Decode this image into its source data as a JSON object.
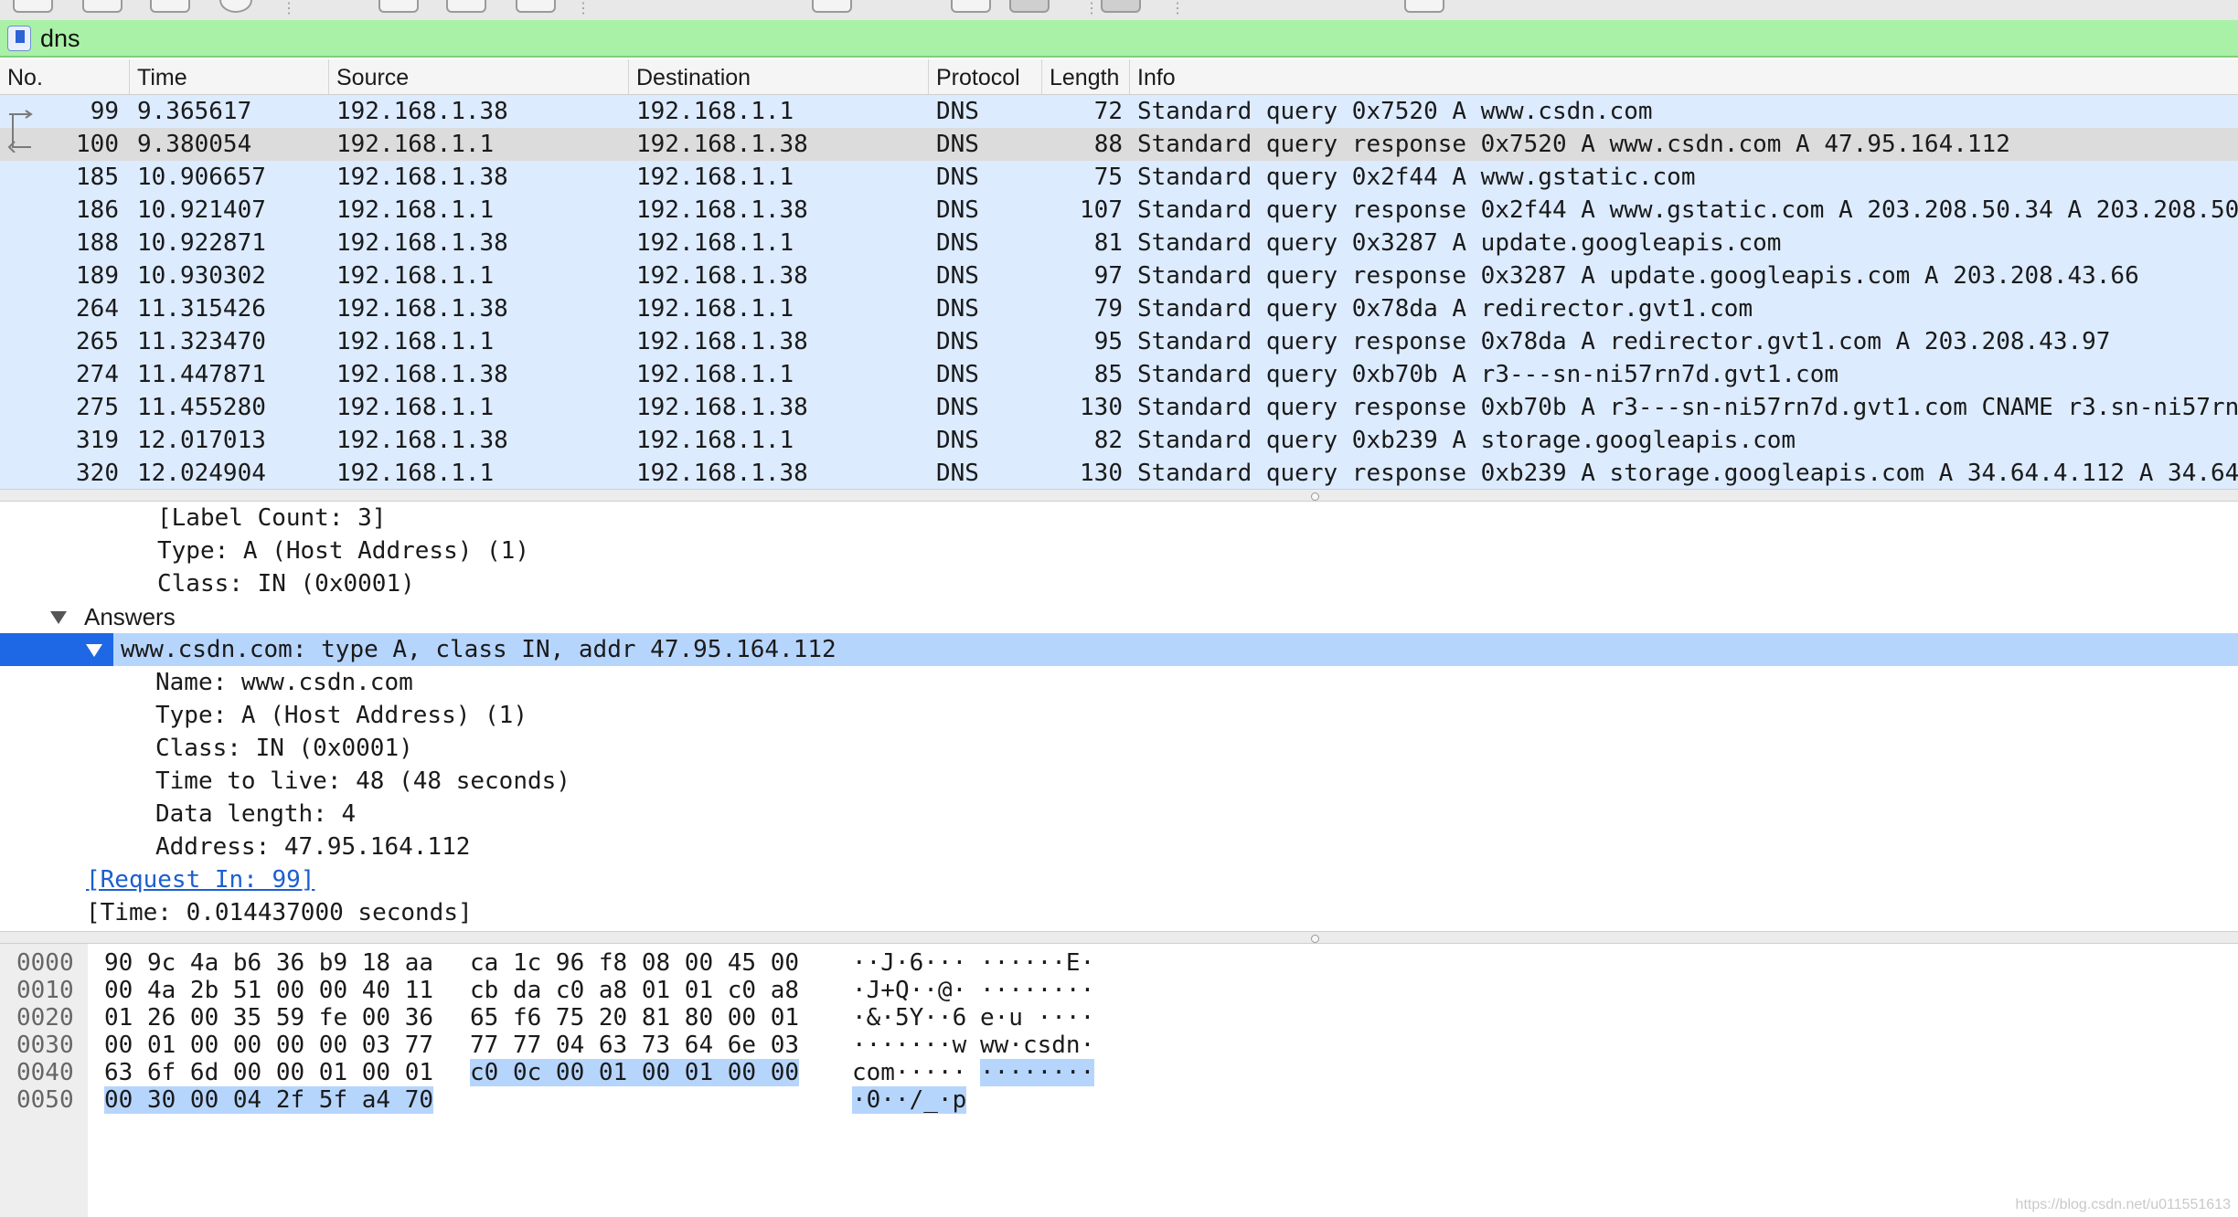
{
  "filter": {
    "value": "dns"
  },
  "packet_list": {
    "columns": [
      "No.",
      "Time",
      "Source",
      "Destination",
      "Protocol",
      "Length",
      "Info"
    ],
    "rows": [
      {
        "no": "99",
        "time": "9.365617",
        "src": "192.168.1.38",
        "dst": "192.168.1.1",
        "proto": "DNS",
        "len": "72",
        "info": "Standard query 0x7520 A www.csdn.com"
      },
      {
        "no": "100",
        "time": "9.380054",
        "src": "192.168.1.1",
        "dst": "192.168.1.38",
        "proto": "DNS",
        "len": "88",
        "info": "Standard query response 0x7520 A www.csdn.com A 47.95.164.112",
        "selected": true
      },
      {
        "no": "185",
        "time": "10.906657",
        "src": "192.168.1.38",
        "dst": "192.168.1.1",
        "proto": "DNS",
        "len": "75",
        "info": "Standard query 0x2f44 A www.gstatic.com"
      },
      {
        "no": "186",
        "time": "10.921407",
        "src": "192.168.1.1",
        "dst": "192.168.1.38",
        "proto": "DNS",
        "len": "107",
        "info": "Standard query response 0x2f44 A www.gstatic.com A 203.208.50.34 A 203.208.50"
      },
      {
        "no": "188",
        "time": "10.922871",
        "src": "192.168.1.38",
        "dst": "192.168.1.1",
        "proto": "DNS",
        "len": "81",
        "info": "Standard query 0x3287 A update.googleapis.com"
      },
      {
        "no": "189",
        "time": "10.930302",
        "src": "192.168.1.1",
        "dst": "192.168.1.38",
        "proto": "DNS",
        "len": "97",
        "info": "Standard query response 0x3287 A update.googleapis.com A 203.208.43.66"
      },
      {
        "no": "264",
        "time": "11.315426",
        "src": "192.168.1.38",
        "dst": "192.168.1.1",
        "proto": "DNS",
        "len": "79",
        "info": "Standard query 0x78da A redirector.gvt1.com"
      },
      {
        "no": "265",
        "time": "11.323470",
        "src": "192.168.1.1",
        "dst": "192.168.1.38",
        "proto": "DNS",
        "len": "95",
        "info": "Standard query response 0x78da A redirector.gvt1.com A 203.208.43.97"
      },
      {
        "no": "274",
        "time": "11.447871",
        "src": "192.168.1.38",
        "dst": "192.168.1.1",
        "proto": "DNS",
        "len": "85",
        "info": "Standard query 0xb70b A r3---sn-ni57rn7d.gvt1.com"
      },
      {
        "no": "275",
        "time": "11.455280",
        "src": "192.168.1.1",
        "dst": "192.168.1.38",
        "proto": "DNS",
        "len": "130",
        "info": "Standard query response 0xb70b A r3---sn-ni57rn7d.gvt1.com CNAME r3.sn-ni57rn"
      },
      {
        "no": "319",
        "time": "12.017013",
        "src": "192.168.1.38",
        "dst": "192.168.1.1",
        "proto": "DNS",
        "len": "82",
        "info": "Standard query 0xb239 A storage.googleapis.com"
      },
      {
        "no": "320",
        "time": "12.024904",
        "src": "192.168.1.1",
        "dst": "192.168.1.38",
        "proto": "DNS",
        "len": "130",
        "info": "Standard query response 0xb239 A storage.googleapis.com A 34.64.4.112 A 34.64"
      }
    ]
  },
  "details": {
    "label_count": "[Label Count: 3]",
    "type_q": "Type: A (Host Address) (1)",
    "class_q": "Class: IN (0x0001)",
    "answers": "Answers",
    "answer_summary": "www.csdn.com: type A, class IN, addr 47.95.164.112",
    "name": "Name: www.csdn.com",
    "type_a": "Type: A (Host Address) (1)",
    "class_a": "Class: IN (0x0001)",
    "ttl": "Time to live: 48 (48 seconds)",
    "data_length": "Data length: 4",
    "address": "Address: 47.95.164.112",
    "request_in": "[Request In: 99]",
    "time": "[Time: 0.014437000 seconds]"
  },
  "bytes": {
    "rows": [
      {
        "off": "0000",
        "h1": "90 9c 4a b6 36 b9 18 aa",
        "h2": "ca 1c 96 f8 08 00 45 00",
        "a1": "··J·6···",
        "a2": "······E·"
      },
      {
        "off": "0010",
        "h1": "00 4a 2b 51 00 00 40 11",
        "h2": "cb da c0 a8 01 01 c0 a8",
        "a1": "·J+Q··@·",
        "a2": "········"
      },
      {
        "off": "0020",
        "h1": "01 26 00 35 59 fe 00 36",
        "h2": "65 f6 75 20 81 80 00 01",
        "a1": "·&·5Y··6",
        "a2": "e·u ····"
      },
      {
        "off": "0030",
        "h1": "00 01 00 00 00 00 03 77",
        "h2": "77 77 04 63 73 64 6e 03",
        "a1": "·······w",
        "a2": "ww·csdn·"
      },
      {
        "off": "0040",
        "h1": "63 6f 6d 00 00 01 00 01",
        "h2": "c0 0c 00 01 00 01 00 00",
        "a1": "com·····",
        "a2": "········"
      },
      {
        "off": "0050",
        "h1": "00 30 00 04 2f 5f a4 70",
        "h2": "",
        "a1": "·0··/_·p",
        "a2": ""
      }
    ]
  },
  "watermark": "https://blog.csdn.net/u011551613"
}
